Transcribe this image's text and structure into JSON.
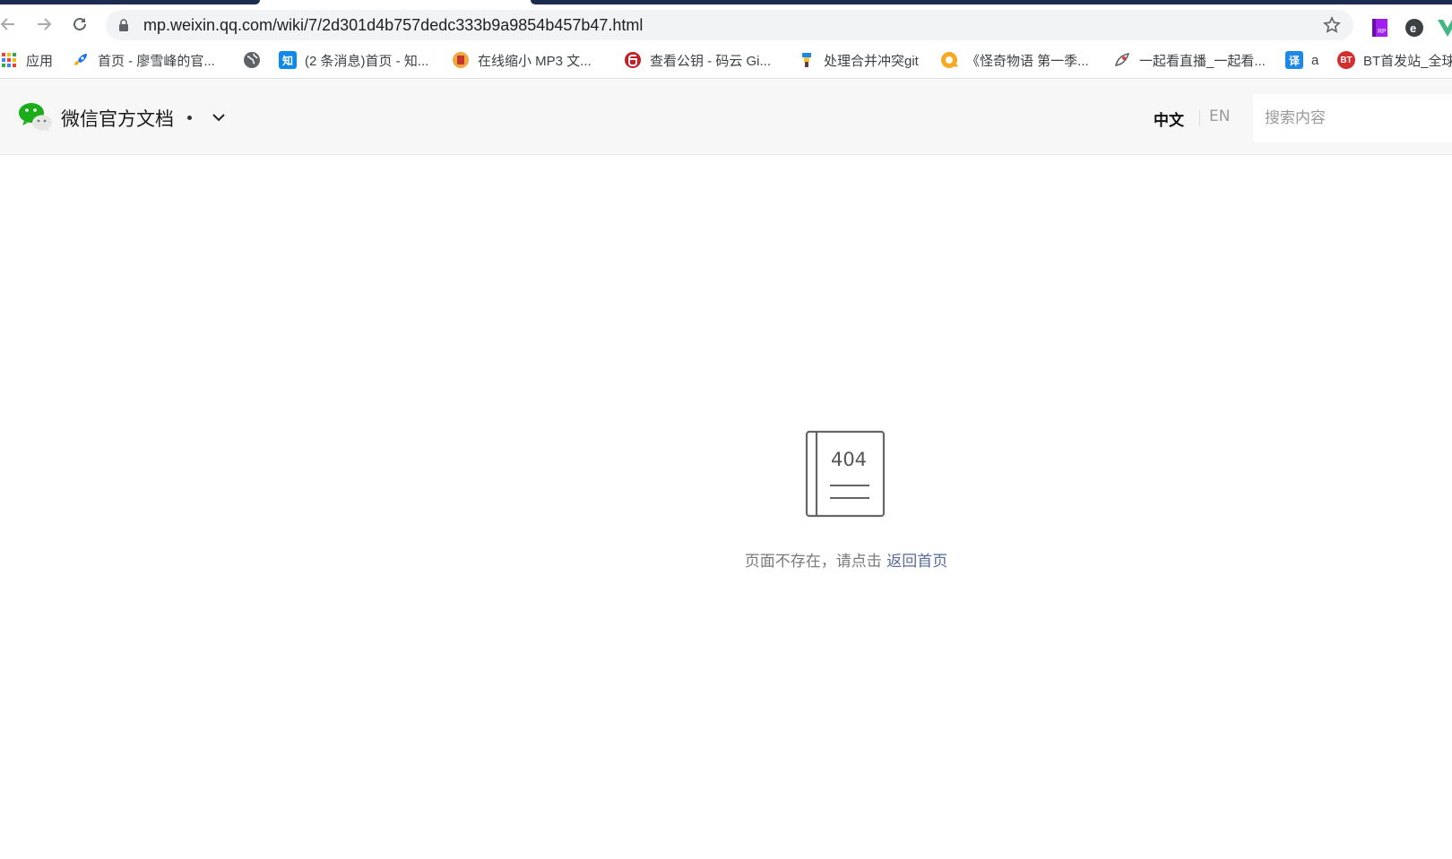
{
  "browser": {
    "url": "mp.weixin.qq.com/wiki/7/2d301d4b757dedc333b9a9854b457b47.html",
    "bookmarks": [
      {
        "label": "应用",
        "icon": "apps-grid-icon"
      },
      {
        "label": "首页 - 廖雪峰的官...",
        "icon": "rocket-icon"
      },
      {
        "label": "",
        "icon": "globe-icon"
      },
      {
        "label": "(2 条消息)首页 - 知...",
        "icon": "zhihu-icon"
      },
      {
        "label": "在线缩小 MP3 文...",
        "icon": "mp3-compress-icon"
      },
      {
        "label": "查看公钥 - 码云 Gi...",
        "icon": "gitee-icon"
      },
      {
        "label": "处理合并冲突git",
        "icon": "git-merge-icon"
      },
      {
        "label": "《怪奇物语 第一季...",
        "icon": "video-icon"
      },
      {
        "label": "一起看直播_一起看...",
        "icon": "live-icon"
      },
      {
        "label": "a",
        "icon": "translate-icon"
      },
      {
        "label": "BT首发站_全球",
        "icon": "bt-icon"
      }
    ],
    "translate_glyph": "译",
    "zhihu_glyph": "知",
    "bt_glyph": "BT"
  },
  "site": {
    "title": "微信官方文档",
    "lang_cn": "中文",
    "lang_en": "EN",
    "search_placeholder": "搜索内容"
  },
  "error": {
    "code": "404",
    "message": "页面不存在，请点击 ",
    "link_label": "返回首页"
  },
  "colors": {
    "wechat_green": "#1aad19",
    "link": "#576b95",
    "tab_strip": "#1c2c50"
  }
}
